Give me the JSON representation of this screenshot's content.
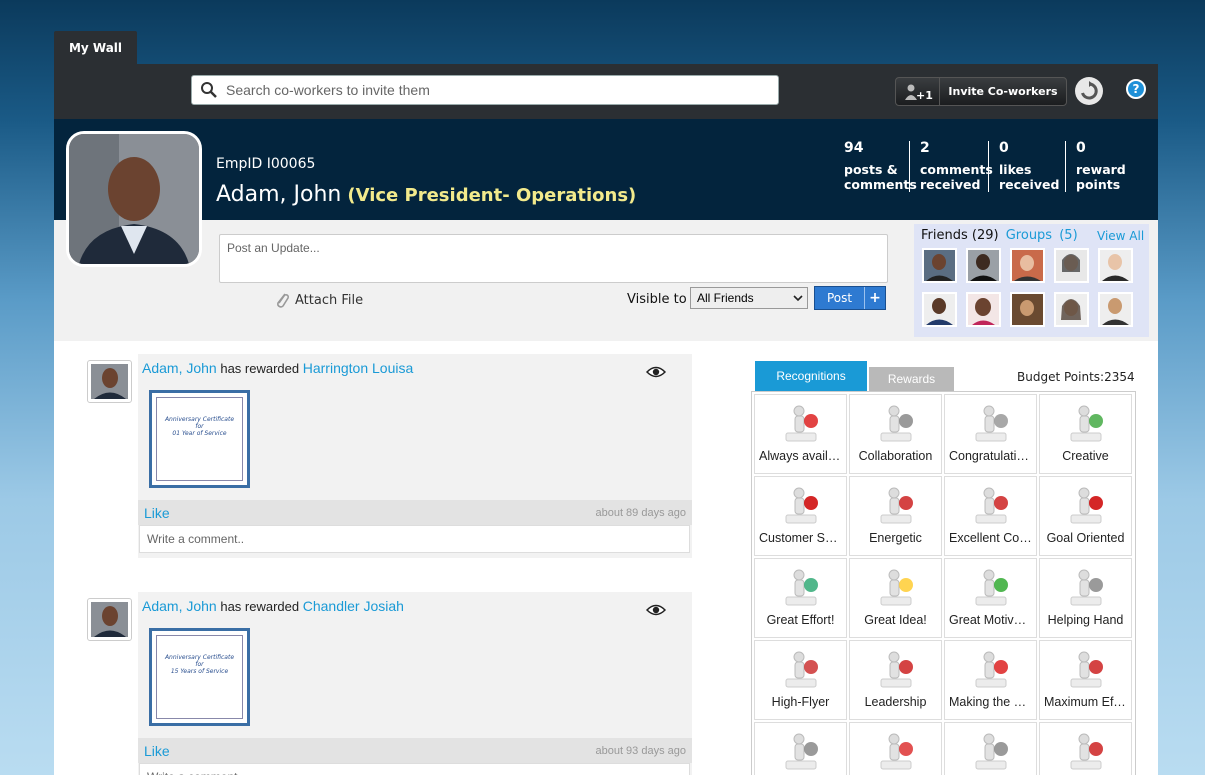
{
  "tabs": {
    "my_wall": "My Wall"
  },
  "search": {
    "placeholder": "Search co-workers to invite them"
  },
  "toolbar": {
    "invite_label": "Invite Co-workers",
    "invite_badge": "+1",
    "help": "?"
  },
  "profile": {
    "emp_id": "EmpID I00065",
    "name": "Adam, John",
    "role": "(Vice President- Operations)",
    "stats": [
      {
        "num": "94",
        "line1": "posts &",
        "line2": "comments"
      },
      {
        "num": "2",
        "line1": "comments",
        "line2": "received"
      },
      {
        "num": "0",
        "line1": "likes",
        "line2": "received"
      },
      {
        "num": "0",
        "line1": "reward",
        "line2": "points"
      }
    ]
  },
  "update": {
    "placeholder": "Post an Update...",
    "attach_label": "Attach File",
    "visible_label": "Visible to",
    "visible_value": "All Friends",
    "post_label": "Post",
    "post_plus": "+"
  },
  "friends": {
    "label": "Friends",
    "count": "(29)",
    "groups_label": "Groups",
    "groups_count": "(5)",
    "view_all": "View All"
  },
  "feed": [
    {
      "actor": "Adam, John",
      "verb": "has rewarded",
      "target": "Harrington Louisa",
      "cert_title": "Anniversary Certificate",
      "cert_for": "for",
      "cert_years": "01 Year of Service",
      "like": "Like",
      "ago": "about 89 days ago",
      "comment_placeholder": "Write a comment.."
    },
    {
      "actor": "Adam, John",
      "verb": "has rewarded",
      "target": "Chandler Josiah",
      "cert_title": "Anniversary Certificate",
      "cert_for": "for",
      "cert_years": "15 Years of Service",
      "like": "Like",
      "ago": "about 93 days ago",
      "comment_placeholder": "Write a comment.."
    }
  ],
  "rewards_panel": {
    "tab_recognitions": "Recognitions",
    "tab_rewards": "Rewards",
    "budget": "Budget Points:2354",
    "items": [
      "Always available",
      "Collaboration",
      "Congratulations",
      "Creative",
      "Customer Service",
      "Energetic",
      "Excellent Contribution",
      "Goal Oriented",
      "Great Effort!",
      "Great Idea!",
      "Great Motivator",
      "Helping Hand",
      "High-Flyer",
      "Leadership",
      "Making the difference",
      "Maximum Effort",
      "",
      "",
      "",
      ""
    ]
  },
  "colors": {
    "accent": "#1a9ad6",
    "header_bg": "#03243d",
    "role": "#f2ea8c"
  }
}
